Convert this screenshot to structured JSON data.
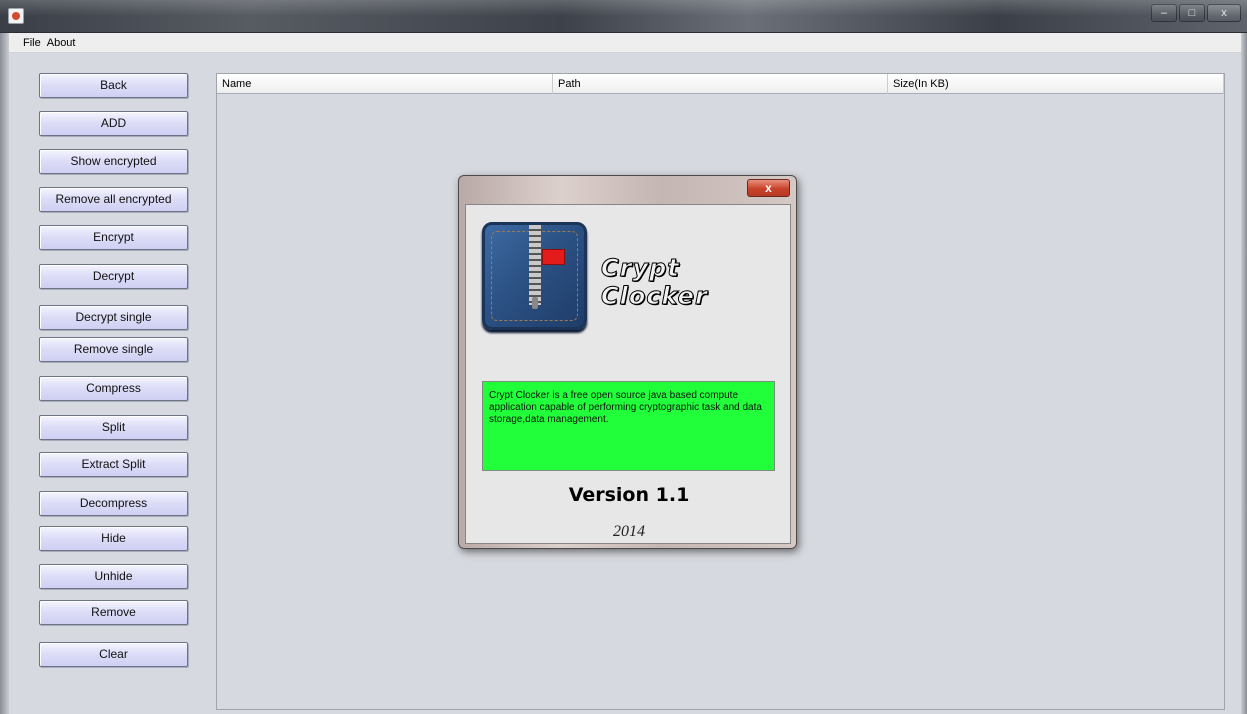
{
  "window": {
    "controls": {
      "minimize": "–",
      "maximize": "□",
      "close": "x"
    }
  },
  "menu": [
    "File",
    "About"
  ],
  "buttons": [
    "Back",
    "ADD",
    "Show encrypted",
    "Remove all encrypted",
    "Encrypt",
    "Decrypt",
    "Decrypt single",
    "Remove single",
    "Compress",
    "Split",
    "Extract Split",
    "Decompress",
    "Hide",
    "Unhide",
    "Remove",
    "Clear"
  ],
  "table": {
    "columns": [
      "Name",
      "Path",
      "Size(In KB)"
    ],
    "rows": []
  },
  "about_dialog": {
    "close_label": "x",
    "brand": "Crypt Clocker",
    "description": "Crypt Clocker is a free open source java  based compute application capable of performing cryptographic task and data storage,data management.",
    "version": "Version 1.1",
    "year": "2014",
    "colors": {
      "description_bg": "#21ff3a",
      "flag": "#e31b1b",
      "logo": "#2a4f81"
    }
  }
}
